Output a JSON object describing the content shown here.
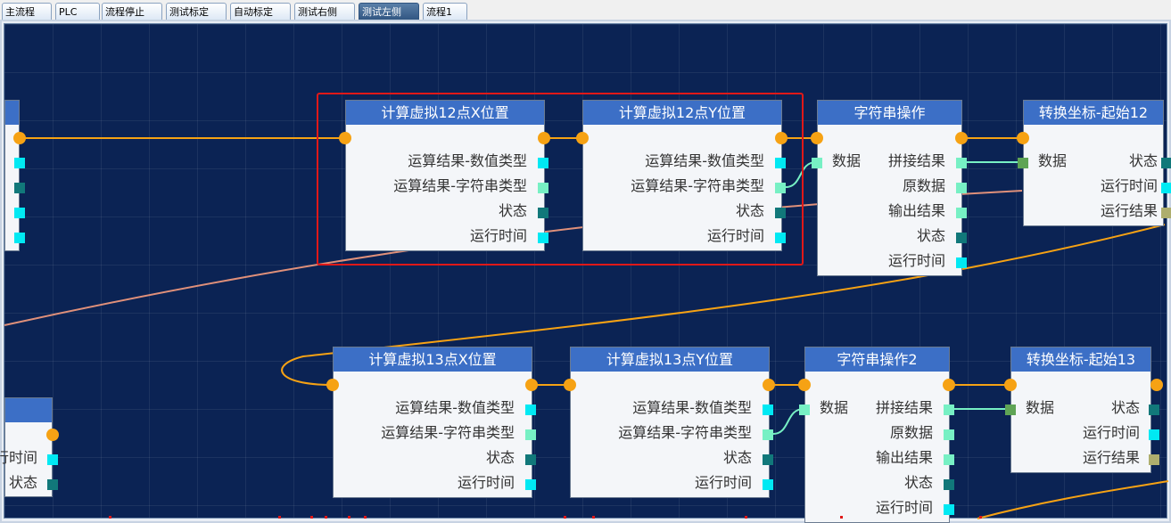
{
  "tabs": [
    {
      "label": "主流程",
      "active": false
    },
    {
      "label": "PLC",
      "active": false
    },
    {
      "label": "流程停止",
      "active": false
    },
    {
      "label": "测试标定",
      "active": false
    },
    {
      "label": "自动标定",
      "active": false
    },
    {
      "label": "测试右侧",
      "active": false
    },
    {
      "label": "测试左侧",
      "active": true
    },
    {
      "label": "流程1",
      "active": false
    }
  ],
  "nodes": {
    "partial_top_left": {
      "title": ""
    },
    "calc12x": {
      "title": "计算虚拟12点X位置",
      "outputs": [
        "运算结果-数值类型",
        "运算结果-字符串类型",
        "状态",
        "运行时间"
      ]
    },
    "calc12y": {
      "title": "计算虚拟12点Y位置",
      "outputs": [
        "运算结果-数值类型",
        "运算结果-字符串类型",
        "状态",
        "运行时间"
      ]
    },
    "str_op": {
      "title": "字符串操作",
      "input": "数据",
      "outputs": [
        "拼接结果",
        "原数据",
        "输出结果",
        "状态",
        "运行时间"
      ]
    },
    "convert12": {
      "title": "转换坐标-起始12",
      "input": "数据",
      "outputs": [
        "状态",
        "运行时间",
        "运行结果"
      ]
    },
    "partial_bottom_left": {
      "title": "",
      "outputs": [
        "运行时间",
        "状态"
      ]
    },
    "calc13x": {
      "title": "计算虚拟13点X位置",
      "outputs": [
        "运算结果-数值类型",
        "运算结果-字符串类型",
        "状态",
        "运行时间"
      ]
    },
    "calc13y": {
      "title": "计算虚拟13点Y位置",
      "outputs": [
        "运算结果-数值类型",
        "运算结果-字符串类型",
        "状态",
        "运行时间"
      ]
    },
    "str_op2": {
      "title": "字符串操作2",
      "input": "数据",
      "outputs": [
        "拼接结果",
        "原数据",
        "输出结果",
        "状态",
        "运行时间"
      ]
    },
    "convert13": {
      "title": "转换坐标-起始13",
      "input": "数据",
      "outputs": [
        "状态",
        "运行时间",
        "运行结果"
      ]
    }
  },
  "colors": {
    "canvas_bg": "#0b2354",
    "node_header": "#3c6fc6",
    "flow_wire": "#f6a214",
    "data_wire": "#77f0c4",
    "link_wire": "#e0907a",
    "selection": "#e01818"
  }
}
